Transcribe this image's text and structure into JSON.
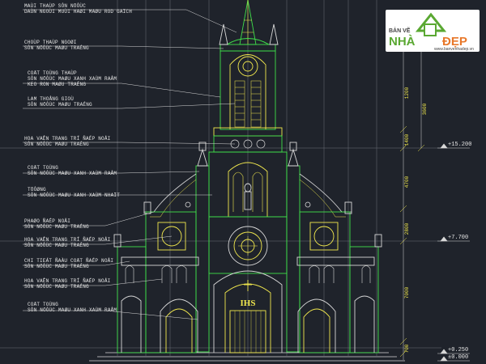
{
  "annotations": [
    {
      "line1": "MAÙI THAÙP SÔN NÖÔÙC",
      "line2": "DAÙN NGOÙI MUÙI HAØI MAØU ROD GAÏCH"
    },
    {
      "line1": "CHOÙP THAÙP NGOØI",
      "line2": "SÔN NÖÔÙC MAØU TRAÉNG"
    },
    {
      "line1": "COÄT TOÙNG THAÙP",
      "line2": "SÔN NÖÔÙC MAØU XANH XAÙM RAÂM",
      "line3": "KEO RON MAØU TRAÉNG"
    },
    {
      "line1": "LAM THOÂNG GIOÙ",
      "line2": "SÔN NÖÔÙC MAØU TRAÉNG"
    },
    {
      "line1": "HOA VAÊN TRANG TRÍ ÑAÉP NOÅI",
      "line2": "SÔN NÖÔÙC MAØU TRAÉNG"
    },
    {
      "line1": "COÄT TOÙNG",
      "line2": "SÔN NÖÔÙC MAØU XANH XAÙM RAÂM"
    },
    {
      "line1": "TÖÔØNG",
      "line2": "SÔN NÖÔÙC MAØU XANH XAÙM NHAÏT"
    },
    {
      "line1": "PHAØO ÑAÉP NOÅI",
      "line2": "SÔN NÖÔÙC MAØU TRAÉNG"
    },
    {
      "line1": "HOA VAÊN TRANG TRÍ ÑAÉP NOÅI",
      "line2": "SÔN NÖÔÙC MAØU TRAÉNG"
    },
    {
      "line1": "CHI TIEÁT ÑAÀU COÄT ÑAÉP NOÅI",
      "line2": "SÔN NÖÔÙC MAØU TRAÉNG"
    },
    {
      "line1": "HOA VAÊN TRANG TRÍ ÑAÉP NOÅI",
      "line2": "SÔN NÖÔÙC MAØU TRAÉNG"
    },
    {
      "line1": "COÄT TOÙNG",
      "line2": "SÔN NÖÔÙC MAØU XANH XAÙM RAÂM"
    }
  ],
  "dimensions": {
    "dim_1": "1200",
    "dim_2": "3600",
    "dim_3": "1400",
    "dim_4": "4700",
    "dim_5": "2800",
    "dim_6": "7000",
    "dim_7": "700"
  },
  "levels": {
    "level_1": "+15.200",
    "level_2": "+7.700",
    "level_3": "+0.250",
    "level_4": "±0.000"
  },
  "facade": {
    "monogram": "IHS"
  },
  "logo": {
    "small_text": "BẢN VẼ",
    "brand_left": "NHÀ",
    "brand_right": "ĐẸP",
    "url": "www.banvenhadep.vn"
  },
  "colors": {
    "background": "#1f232b",
    "structure_green": "#3fe04a",
    "ornament_yellow": "#f2e94e",
    "leader_line": "#d8d8d8",
    "grid_line": "#6a6f7a",
    "logo_green": "#5aa832",
    "logo_orange": "#e8782a"
  }
}
